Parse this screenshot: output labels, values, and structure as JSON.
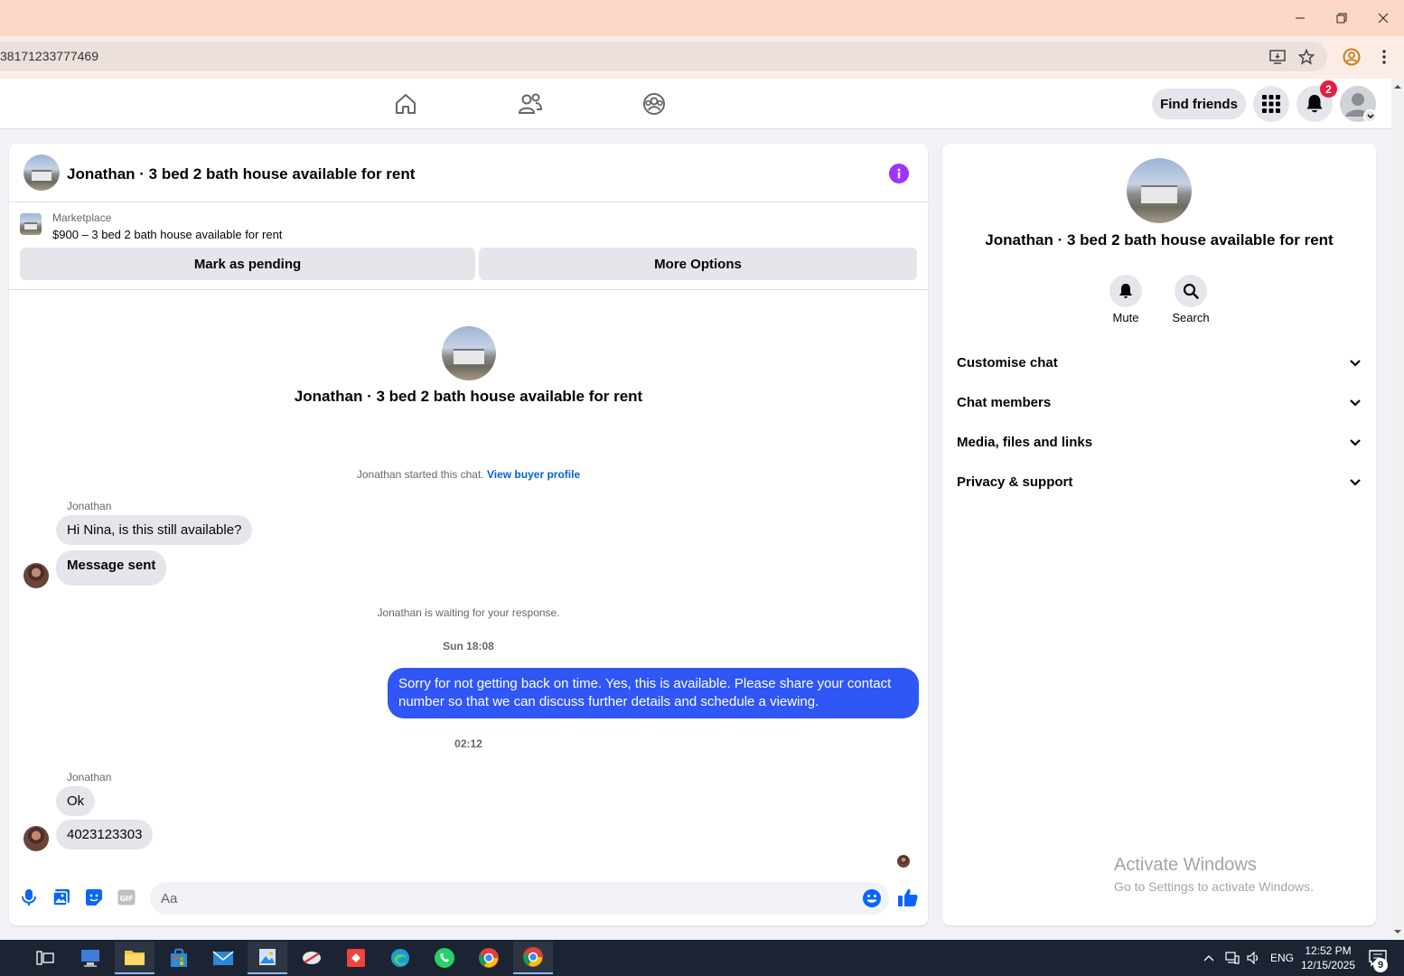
{
  "browser": {
    "url_fragment": "38171233777469",
    "window_controls": [
      "minimize",
      "restore",
      "close"
    ]
  },
  "fb_nav": {
    "find_friends_label": "Find friends",
    "notification_count": "2"
  },
  "chat": {
    "header_title": "Jonathan · 3 bed 2 bath house available for rent",
    "marketplace_label": "Marketplace",
    "listing_price_title": "$900 – 3 bed 2 bath house available for rent",
    "mark_pending_label": "Mark as pending",
    "more_options_label": "More Options",
    "intro_title": "Jonathan · 3 bed 2 bath house available for rent",
    "started_text": "Jonathan started this chat.",
    "view_buyer_profile": "View buyer profile",
    "messages": [
      {
        "sender": "Jonathan",
        "lines": [
          "Hi Nina, is this still available?",
          "Message sent"
        ]
      },
      {
        "system": "Jonathan is waiting for your response."
      },
      {
        "timestamp": "Sun 18:08"
      },
      {
        "outgoing": "Sorry for not getting back on time. Yes, this is available. Please share your contact number so that we can discuss further details and schedule a viewing."
      },
      {
        "timestamp": "02:12"
      },
      {
        "sender": "Jonathan",
        "lines": [
          "Ok",
          "4023123303"
        ]
      }
    ],
    "composer_placeholder": "Aa"
  },
  "info_panel": {
    "title": "Jonathan · 3 bed 2 bath house available for rent",
    "actions": [
      {
        "label": "Mute",
        "icon": "bell-icon"
      },
      {
        "label": "Search",
        "icon": "search-icon"
      }
    ],
    "sections": [
      "Customise chat",
      "Chat members",
      "Media, files and links",
      "Privacy & support"
    ]
  },
  "watermark": {
    "line1": "Activate Windows",
    "line2": "Go to Settings to activate Windows."
  },
  "taskbar": {
    "language": "ENG",
    "time": "12:52 PM",
    "date": "12/15/2025",
    "notification_count": "9"
  },
  "colors": {
    "accent_blue": "#3056f5",
    "fb_blue": "#0064d1",
    "info_purple": "#a033ff",
    "badge_red": "#e41e3f"
  }
}
